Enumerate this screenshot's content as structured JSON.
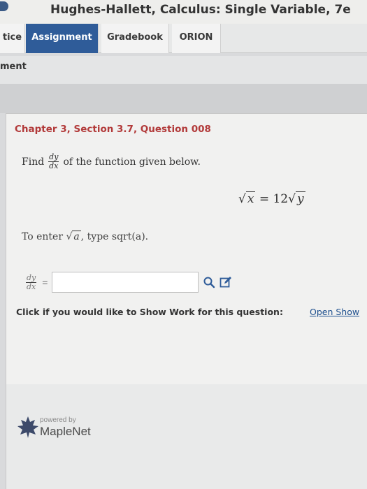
{
  "header": {
    "title": "Hughes-Hallett, Calculus: Single Variable, 7e"
  },
  "tabs": [
    {
      "label": "tice",
      "active": false
    },
    {
      "label": "Assignment",
      "active": true
    },
    {
      "label": "Gradebook",
      "active": false
    },
    {
      "label": "ORION",
      "active": false
    }
  ],
  "subtitle": "ment",
  "question": {
    "title": "Chapter 3, Section 3.7, Question 008",
    "find_prefix": "Find",
    "find_suffix": "of the function given below.",
    "deriv_num": "dy",
    "deriv_den": "dx",
    "equation_lhs_radicand": "x",
    "equation_mid": "= 12",
    "equation_rhs_radicand": "y",
    "hint_prefix": "To enter",
    "hint_radicand": "a",
    "hint_suffix": ", type sqrt(a).",
    "answer_value": "",
    "answer_eq": "="
  },
  "show_work": {
    "prompt": "Click if you would like to Show Work for this question:",
    "link": "Open Show"
  },
  "footer": {
    "powered": "powered by",
    "brand": "MapleNet"
  },
  "colors": {
    "accent": "#2f5c99",
    "question_title": "#b23a3a",
    "link": "#1d4f8e"
  },
  "icons": [
    "search-icon",
    "edit-icon",
    "maple-leaf-icon"
  ]
}
